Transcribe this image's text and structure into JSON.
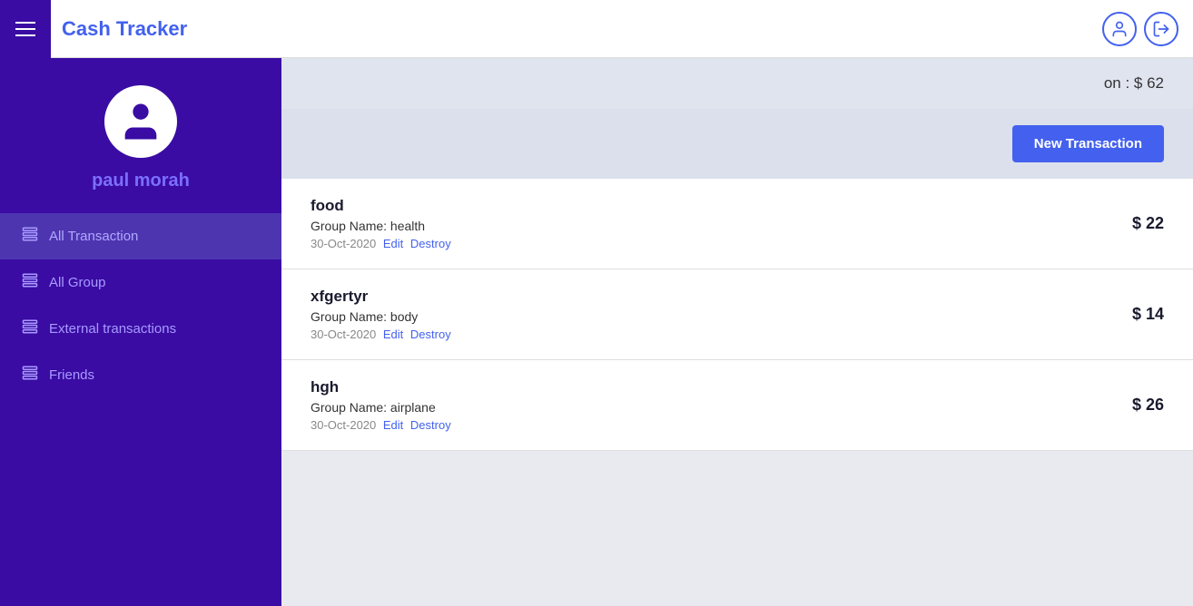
{
  "header": {
    "title": "Cash Tracker",
    "hamburger_label": "menu"
  },
  "sidebar": {
    "username": "paul morah",
    "nav_items": [
      {
        "id": "all-transaction",
        "label": "All Transaction",
        "active": true
      },
      {
        "id": "all-group",
        "label": "All Group",
        "active": false
      },
      {
        "id": "external-transactions",
        "label": "External transactions",
        "active": false
      },
      {
        "id": "friends",
        "label": "Friends",
        "active": false
      }
    ]
  },
  "main": {
    "balance_label": "on :",
    "balance_amount": "$ 62",
    "new_transaction_btn": "New Transaction",
    "transactions": [
      {
        "name": "food",
        "group": "Group Name: health",
        "date": "30-Oct-2020",
        "amount": "$ 22",
        "edit_label": "Edit",
        "destroy_label": "Destroy"
      },
      {
        "name": "xfgertyr",
        "group": "Group Name: body",
        "date": "30-Oct-2020",
        "amount": "$ 14",
        "edit_label": "Edit",
        "destroy_label": "Destroy"
      },
      {
        "name": "hgh",
        "group": "Group Name: airplane",
        "date": "30-Oct-2020",
        "amount": "$ 26",
        "edit_label": "Edit",
        "destroy_label": "Destroy"
      }
    ]
  },
  "colors": {
    "sidebar_bg": "#3a0ca3",
    "accent": "#4361ee",
    "active_nav": "#4e35b0"
  }
}
